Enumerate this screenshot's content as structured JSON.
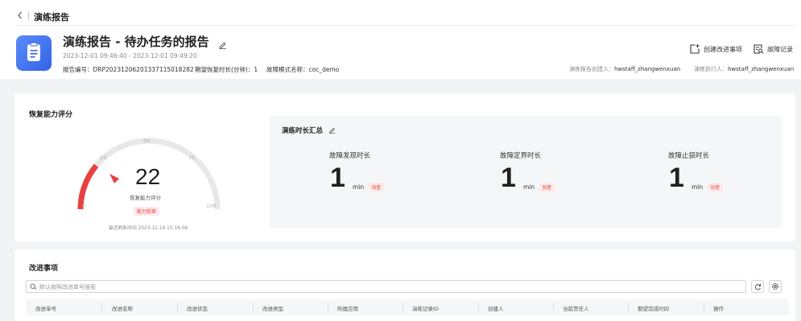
{
  "breadcrumb": {
    "title": "演练报告"
  },
  "report": {
    "title": "演练报告 - 待办任务的报告",
    "time_range": "2023-12-01 09:46:40 - 2023-12-01 09:49:20",
    "report_no_label": "报告编号：",
    "report_no": "DRP20231206201337115018282",
    "expected_recovery_label": "期望恢复时长(分钟)：",
    "expected_recovery": "1",
    "fault_mode_label": "故障模式名称：",
    "fault_mode": "coc_demo",
    "creator_label": "演练报告创建人：",
    "creator": "hwstaff_zhangwenxuan",
    "executor_label": "演练执行人：",
    "executor": "hwstaff_zhangwenxuan"
  },
  "actions": {
    "create_improvement": "创建改进事项",
    "fault_record": "故障记录"
  },
  "recovery": {
    "section_title": "恢复能力评分",
    "score": "22",
    "score_value": 22,
    "score_label": "恢复能力评分",
    "level_badge": "能力较差",
    "refresh_time": "最近刷新时间 2023-12-18 15:16:06",
    "ticks": [
      "0",
      "25",
      "50",
      "75",
      "100"
    ]
  },
  "duration": {
    "section_title": "演练时长汇总",
    "metrics": [
      {
        "label": "故障发现时长",
        "value": "1",
        "unit": "min",
        "badge": "较差"
      },
      {
        "label": "故障定界时长",
        "value": "1",
        "unit": "min",
        "badge": "较差"
      },
      {
        "label": "故障止损时长",
        "value": "1",
        "unit": "min",
        "badge": "较差"
      }
    ]
  },
  "improvements": {
    "section_title": "改进事项",
    "search_placeholder": "默认按照改进单号搜索",
    "columns": [
      "改进单号",
      "改进名称",
      "改进状态",
      "改进类型",
      "所属应用",
      "演练记录ID",
      "创建人",
      "当前责任人",
      "期望完成时间",
      "操作"
    ]
  },
  "colors": {
    "accent": "#3563e9",
    "danger": "#e84040",
    "gauge_track": "#e8e8e8"
  },
  "icons": [
    "back-arrow-icon",
    "app-report-icon",
    "edit-icon",
    "create-improvement-icon",
    "fault-record-icon",
    "search-icon",
    "refresh-icon",
    "settings-icon",
    "gauge-pointer-icon"
  ]
}
